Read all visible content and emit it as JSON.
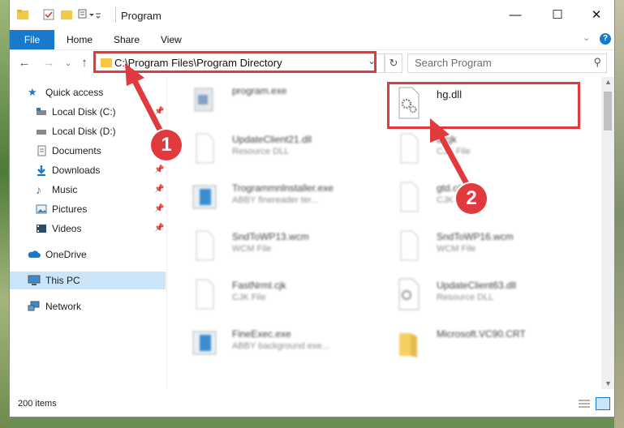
{
  "window": {
    "title": "Program",
    "controls": {
      "minimize": "—",
      "maximize": "☐",
      "close": "✕"
    }
  },
  "ribbon": {
    "tabs": [
      "File",
      "Home",
      "Share",
      "View"
    ]
  },
  "address": {
    "path": "C:\\Program Files\\Program Directory"
  },
  "search": {
    "placeholder": "Search Program"
  },
  "sidebar": {
    "items": [
      {
        "label": "Quick access",
        "icon": "star-icon"
      },
      {
        "label": "Local Disk (C:)",
        "icon": "drive-icon",
        "pinned": true
      },
      {
        "label": "Local Disk (D:)",
        "icon": "drive-icon"
      },
      {
        "label": "Documents",
        "icon": "documents-icon"
      },
      {
        "label": "Downloads",
        "icon": "downloads-icon",
        "pinned": true
      },
      {
        "label": "Music",
        "icon": "music-icon",
        "pinned": true
      },
      {
        "label": "Pictures",
        "icon": "pictures-icon",
        "pinned": true
      },
      {
        "label": "Videos",
        "icon": "videos-icon",
        "pinned": true
      },
      {
        "label": "OneDrive",
        "icon": "cloud-icon"
      },
      {
        "label": "This PC",
        "icon": "computer-icon",
        "selected": true
      },
      {
        "label": "Network",
        "icon": "network-icon"
      }
    ]
  },
  "files": {
    "left": [
      {
        "name": "program.exe",
        "type": ""
      },
      {
        "name": "UpdateClient21.dll",
        "type": "Resource DLL"
      },
      {
        "name": "Trogrammnlnstaller.exe",
        "type": "ABBY finereader ter..."
      },
      {
        "name": "SndToWP13.wcm",
        "type": "WCM File"
      },
      {
        "name": "FastNrml.cjk",
        "type": "CJK File"
      },
      {
        "name": "FineExec.exe",
        "type": "ABBY background exe..."
      }
    ],
    "right": [
      {
        "name": "hg.dll",
        "type": ""
      },
      {
        "name": "d.cjk",
        "type": "CJK File"
      },
      {
        "name": "gtd.cjk",
        "type": "CJK File"
      },
      {
        "name": "SndToWP16.wcm",
        "type": "WCM File"
      },
      {
        "name": "UpdateClient63.dll",
        "type": "Resource DLL"
      },
      {
        "name": "Microsoft.VC90.CRT",
        "type": ""
      }
    ]
  },
  "status": {
    "count": "200 items"
  },
  "annotations": {
    "step1": "1",
    "step2": "2"
  },
  "colors": {
    "accent": "#1979ca",
    "highlight": "#e0393e"
  }
}
